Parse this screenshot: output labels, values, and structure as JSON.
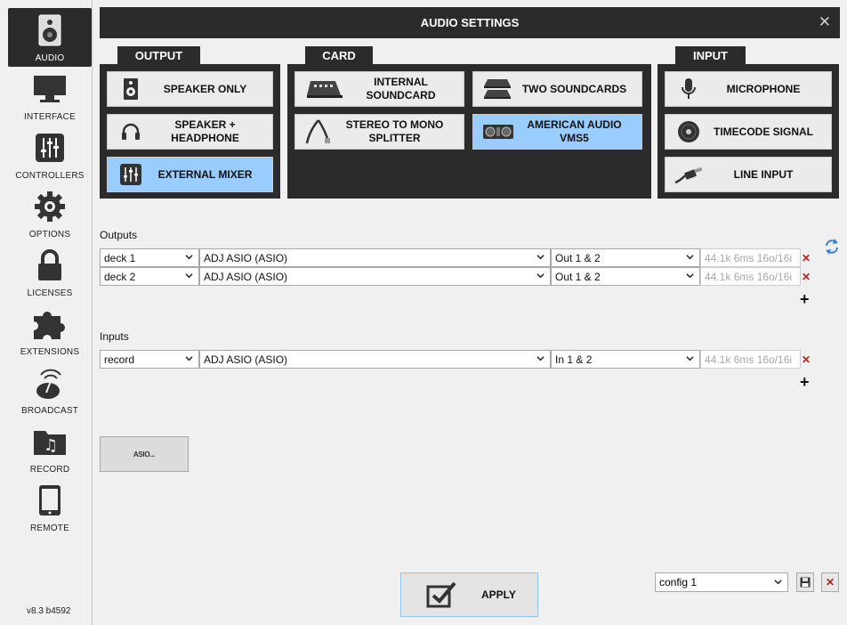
{
  "window": {
    "title": "AUDIO SETTINGS",
    "close_glyph": "✕"
  },
  "sidebar": {
    "items": [
      {
        "label": "AUDIO",
        "icon": "speaker-icon",
        "active": true
      },
      {
        "label": "INTERFACE",
        "icon": "monitor-icon"
      },
      {
        "label": "CONTROLLERS",
        "icon": "mixer-sliders-icon"
      },
      {
        "label": "OPTIONS",
        "icon": "gear-icon"
      },
      {
        "label": "LICENSES",
        "icon": "lock-icon"
      },
      {
        "label": "EXTENSIONS",
        "icon": "puzzle-icon"
      },
      {
        "label": "BROADCAST",
        "icon": "broadcast-icon"
      },
      {
        "label": "RECORD",
        "icon": "folder-music-icon"
      },
      {
        "label": "REMOTE",
        "icon": "tablet-icon"
      }
    ],
    "version": "v8.3 b4592"
  },
  "output": {
    "tab": "OUTPUT",
    "buttons": [
      {
        "label": "SPEAKER ONLY",
        "icon": "speaker-icon"
      },
      {
        "label": "SPEAKER + HEADPHONE",
        "icon": "headphone-icon"
      },
      {
        "label": "EXTERNAL MIXER",
        "icon": "mixer-icon",
        "selected": true
      }
    ]
  },
  "card": {
    "tab": "CARD",
    "buttons": [
      {
        "label": "INTERNAL SOUNDCARD",
        "icon": "soundcard-icon"
      },
      {
        "label": "TWO SOUNDCARDS",
        "icon": "two-soundcards-icon"
      },
      {
        "label": "STEREO TO MONO SPLITTER",
        "icon": "splitter-cable-icon"
      },
      {
        "label": "AMERICAN AUDIO VMS5",
        "icon": "controller-device-icon",
        "selected": true
      }
    ]
  },
  "input": {
    "tab": "INPUT",
    "buttons": [
      {
        "label": "MICROPHONE",
        "icon": "microphone-icon"
      },
      {
        "label": "TIMECODE SIGNAL",
        "icon": "vinyl-icon"
      },
      {
        "label": "LINE INPUT",
        "icon": "line-cable-icon"
      }
    ]
  },
  "outputs_section": {
    "label": "Outputs",
    "rows": [
      {
        "channel": "deck 1",
        "device": "ADJ ASIO (ASIO)",
        "ports": "Out 1 & 2",
        "info": "44.1k 6ms 16o/16i"
      },
      {
        "channel": "deck 2",
        "device": "ADJ ASIO (ASIO)",
        "ports": "Out 1 & 2",
        "info": "44.1k 6ms 16o/16i"
      }
    ]
  },
  "inputs_section": {
    "label": "Inputs",
    "rows": [
      {
        "channel": "record",
        "device": "ADJ ASIO (ASIO)",
        "ports": "In 1 & 2",
        "info": "44.1k 6ms 16o/16i"
      }
    ]
  },
  "asio_button": {
    "label": "ASIO..."
  },
  "apply_button": {
    "label": "APPLY"
  },
  "config": {
    "selected": "config 1"
  },
  "colors": {
    "dark": "#2b2b2b",
    "selected": "#99ccff",
    "delete": "#b02020"
  }
}
